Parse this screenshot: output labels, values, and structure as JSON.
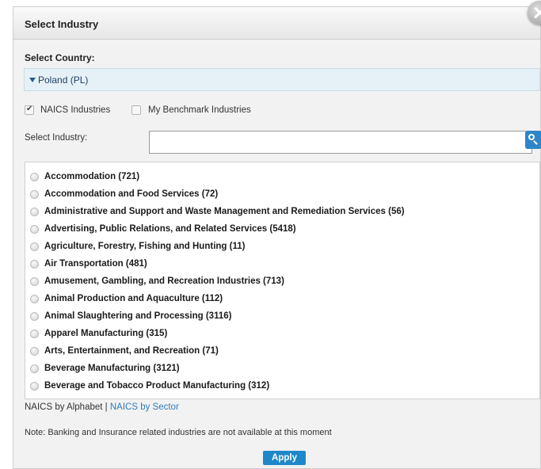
{
  "dialog": {
    "title": "Select Industry"
  },
  "country": {
    "label": "Select Country:",
    "selected": "Poland (PL)"
  },
  "filters": [
    {
      "label": "NAICS Industries",
      "checked": true
    },
    {
      "label": "My Benchmark Industries",
      "checked": false
    }
  ],
  "search": {
    "label": "Select Industry:",
    "value": ""
  },
  "industries": [
    "Accommodation (721)",
    "Accommodation and Food Services (72)",
    "Administrative and Support and Waste Management and Remediation Services (56)",
    "Advertising, Public Relations, and Related Services (5418)",
    "Agriculture, Forestry, Fishing and Hunting (11)",
    "Air Transportation (481)",
    "Amusement, Gambling, and Recreation Industries (713)",
    "Animal Production and Aquaculture (112)",
    "Animal Slaughtering and Processing (3116)",
    "Apparel Manufacturing (315)",
    "Arts, Entertainment, and Recreation (71)",
    "Beverage Manufacturing (3121)",
    "Beverage and Tobacco Product Manufacturing (312)"
  ],
  "footer": {
    "by_alphabet": "NAICS by Alphabet",
    "separator": "|",
    "by_sector": "NAICS by Sector",
    "note": "Note: Banking and Insurance related industries are not available at this moment",
    "apply": "Apply"
  }
}
